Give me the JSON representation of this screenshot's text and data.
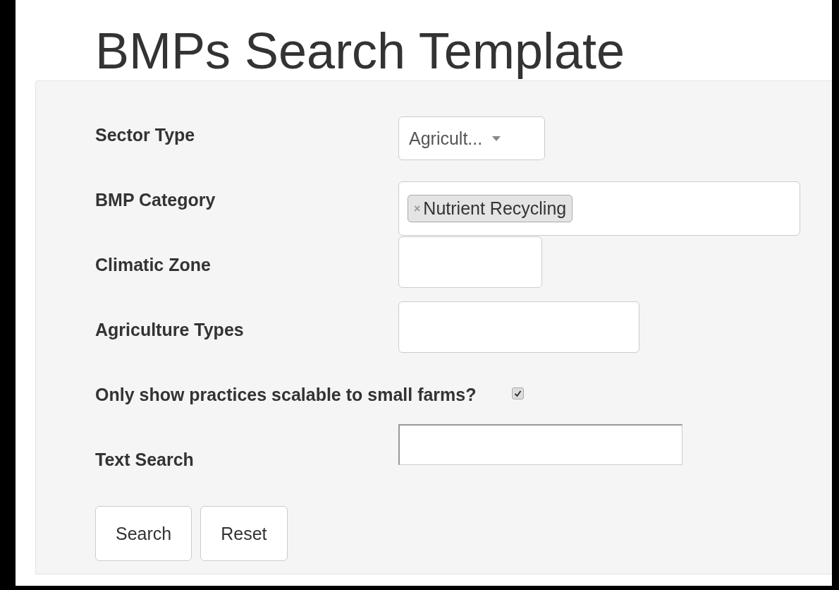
{
  "title": "BMPs Search Template",
  "form": {
    "rows": [
      {
        "kind": "select",
        "label": "Sector Type",
        "value": "Agricult..."
      },
      {
        "kind": "tags",
        "label": "BMP Category",
        "tags": [
          "Nutrient Recycling"
        ],
        "remove": "×"
      },
      {
        "kind": "short-text",
        "label": "Climatic Zone"
      },
      {
        "kind": "long-text",
        "label": "Agriculture Types"
      },
      {
        "kind": "checkbox",
        "label": "Only show practices scalable to small farms?",
        "checked": true
      },
      {
        "kind": "search",
        "label": "Text Search"
      }
    ],
    "buttons": [
      "Search",
      "Reset"
    ]
  }
}
